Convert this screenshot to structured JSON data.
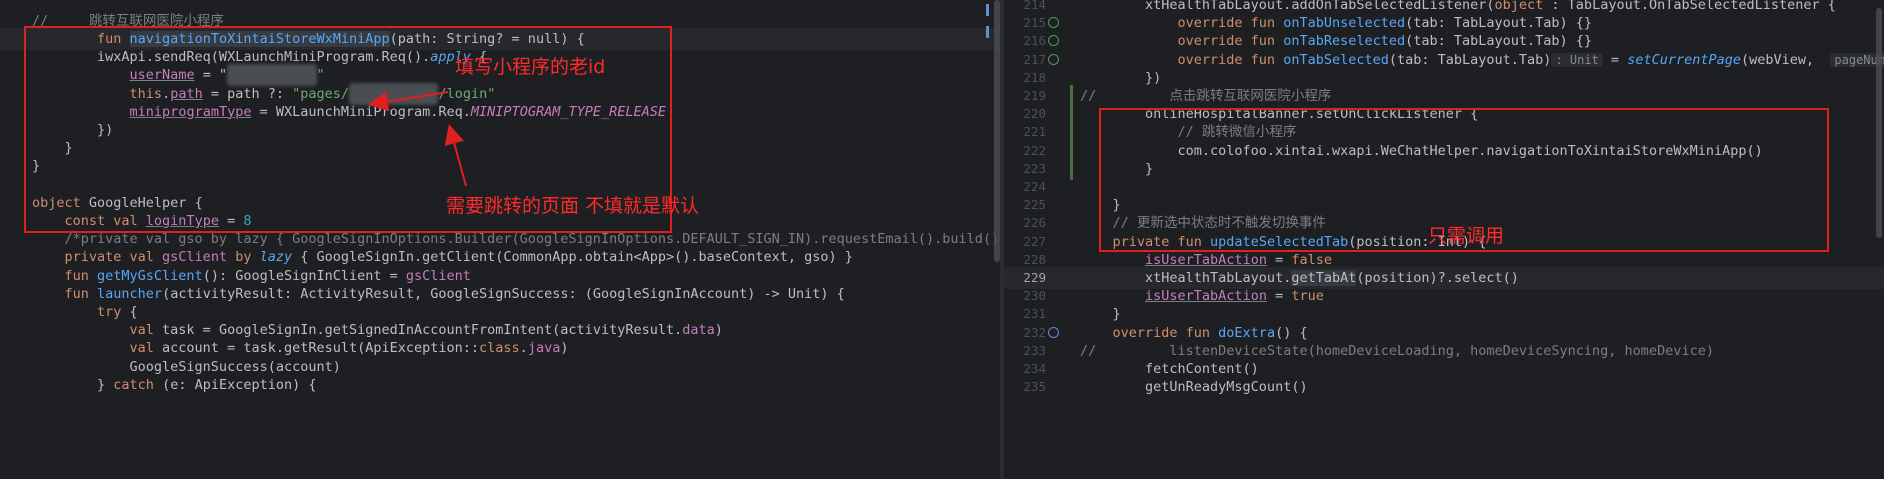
{
  "left_editor": {
    "lines": [
      {
        "tokens": [
          {
            "t": "//     跳转互联网医院小程序",
            "c": "cm"
          }
        ]
      },
      {
        "tokens": [
          {
            "t": "        fun ",
            "c": "kw"
          },
          {
            "t": "navigationToXintaiStoreWxMiniApp",
            "c": "fn hl"
          },
          {
            "t": "(path: String? = null) {",
            "c": ""
          }
        ]
      },
      {
        "tokens": [
          {
            "t": "        iwxApi.sendReq(WXLaunchMiniProgram.Req().",
            "c": ""
          },
          {
            "t": "apply",
            "c": "fn it"
          },
          {
            "t": " {",
            "c": ""
          }
        ]
      },
      {
        "tokens": [
          {
            "t": "            ",
            "c": ""
          },
          {
            "t": "userName",
            "c": "prop und"
          },
          {
            "t": " = \"",
            "c": ""
          },
          {
            "t": "gh_xxxxxxxx",
            "c": "blur"
          },
          {
            "t": "\"",
            "c": "str"
          }
        ]
      },
      {
        "tokens": [
          {
            "t": "            ",
            "c": ""
          },
          {
            "t": "this",
            "c": "kw"
          },
          {
            "t": ".",
            "c": ""
          },
          {
            "t": "path",
            "c": "prop und"
          },
          {
            "t": " = path ?: ",
            "c": ""
          },
          {
            "t": "\"pages/",
            "c": "str"
          },
          {
            "t": "xxxxxxxxxxx",
            "c": "blur"
          },
          {
            "t": "/login\"",
            "c": "str"
          }
        ]
      },
      {
        "tokens": [
          {
            "t": "            ",
            "c": ""
          },
          {
            "t": "miniprogramType",
            "c": "prop und"
          },
          {
            "t": " = WXLaunchMiniProgram.Req.",
            "c": ""
          },
          {
            "t": "MINIPTOGRAM_TYPE_RELEASE",
            "c": "prop it"
          }
        ]
      },
      {
        "tokens": [
          {
            "t": "        })",
            "c": ""
          }
        ]
      },
      {
        "tokens": [
          {
            "t": "    }",
            "c": ""
          }
        ]
      },
      {
        "tokens": [
          {
            "t": "}",
            "c": ""
          }
        ]
      },
      {
        "tokens": [
          {
            "t": "",
            "c": ""
          }
        ]
      },
      {
        "tokens": [
          {
            "t": "object ",
            "c": "kw"
          },
          {
            "t": "GoogleHelper {",
            "c": ""
          }
        ]
      },
      {
        "tokens": [
          {
            "t": "    const val ",
            "c": "kw"
          },
          {
            "t": "loginType",
            "c": "prop und"
          },
          {
            "t": " = ",
            "c": ""
          },
          {
            "t": "8",
            "c": "num"
          }
        ]
      },
      {
        "tokens": [
          {
            "t": "    /*private val gso by lazy { GoogleSignInOptions.Builder(GoogleSignInOptions.DEFAULT_SIGN_IN).requestEmail().build() }*/",
            "c": "cm"
          }
        ]
      },
      {
        "tokens": [
          {
            "t": "    private val ",
            "c": "kw"
          },
          {
            "t": "gsClient",
            "c": "prop"
          },
          {
            "t": " by ",
            "c": "kw"
          },
          {
            "t": "lazy",
            "c": "fn it"
          },
          {
            "t": " { GoogleSignIn.getClient(CommonApp.obtain<App>().baseContext, gso) }",
            "c": ""
          }
        ]
      },
      {
        "tokens": [
          {
            "t": "    fun ",
            "c": "kw"
          },
          {
            "t": "getMyGsClient",
            "c": "fn"
          },
          {
            "t": "(): GoogleSignInClient = ",
            "c": ""
          },
          {
            "t": "gsClient",
            "c": "prop"
          }
        ]
      },
      {
        "tokens": [
          {
            "t": "    fun ",
            "c": "kw"
          },
          {
            "t": "launcher",
            "c": "fn"
          },
          {
            "t": "(activityResult: ActivityResult, GoogleSignSuccess: (GoogleSignInAccount) -> Unit) {",
            "c": ""
          }
        ]
      },
      {
        "tokens": [
          {
            "t": "        try ",
            "c": "kw"
          },
          {
            "t": "{",
            "c": ""
          }
        ]
      },
      {
        "tokens": [
          {
            "t": "            val ",
            "c": "kw"
          },
          {
            "t": "task = GoogleSignIn.getSignedInAccountFromIntent(activityResult.",
            "c": ""
          },
          {
            "t": "data",
            "c": "prop"
          },
          {
            "t": ")",
            "c": ""
          }
        ]
      },
      {
        "tokens": [
          {
            "t": "            val ",
            "c": "kw"
          },
          {
            "t": "account = task.getResult(ApiException::",
            "c": ""
          },
          {
            "t": "class",
            "c": "kw"
          },
          {
            "t": ".",
            "c": ""
          },
          {
            "t": "java",
            "c": "prop"
          },
          {
            "t": ")",
            "c": ""
          }
        ]
      },
      {
        "tokens": [
          {
            "t": "            GoogleSignSuccess(account)",
            "c": ""
          }
        ]
      },
      {
        "tokens": [
          {
            "t": "        } ",
            "c": ""
          },
          {
            "t": "catch ",
            "c": "kw"
          },
          {
            "t": "(e: ApiException) {",
            "c": ""
          }
        ]
      }
    ]
  },
  "right_editor": {
    "lines": [
      {
        "n": "214",
        "tokens": [
          {
            "t": "        xtHealthTabLayout.addOnTabSelectedListener(",
            "c": ""
          },
          {
            "t": "object",
            "c": "kw"
          },
          {
            "t": " : TabLayout.OnTabSelectedListener {",
            "c": ""
          }
        ]
      },
      {
        "n": "215",
        "icon": "green",
        "tokens": [
          {
            "t": "            override fun ",
            "c": "kw"
          },
          {
            "t": "onTabUnselected",
            "c": "fn"
          },
          {
            "t": "(tab: TabLayout.Tab) {}",
            "c": ""
          }
        ]
      },
      {
        "n": "216",
        "icon": "green",
        "tokens": [
          {
            "t": "            override fun ",
            "c": "kw"
          },
          {
            "t": "onTabReselected",
            "c": "fn"
          },
          {
            "t": "(tab: TabLayout.Tab) {}",
            "c": ""
          }
        ]
      },
      {
        "n": "217",
        "icon": "green",
        "tokens": [
          {
            "t": "            override fun ",
            "c": "kw"
          },
          {
            "t": "onTabSelected",
            "c": "fn"
          },
          {
            "t": "(tab: TabLayout.Tab)",
            "c": ""
          },
          {
            "t": ": Unit",
            "c": "hint"
          },
          {
            "t": " = ",
            "c": ""
          },
          {
            "t": "setCurrentPage",
            "c": "fn it"
          },
          {
            "t": "(webView,  ",
            "c": ""
          },
          {
            "t": "pageNumber:",
            "c": "hint"
          }
        ]
      },
      {
        "n": "218",
        "tokens": [
          {
            "t": "        })",
            "c": ""
          }
        ]
      },
      {
        "n": "219",
        "vcs": true,
        "tokens": [
          {
            "t": "//         点击跳转互联网医院小程序",
            "c": "cm"
          }
        ]
      },
      {
        "n": "220",
        "vcs": true,
        "tokens": [
          {
            "t": "        onlineHospitalBanner.setOnClickListener {",
            "c": ""
          }
        ]
      },
      {
        "n": "221",
        "vcs": true,
        "tokens": [
          {
            "t": "            // 跳转微信小程序",
            "c": "cm"
          }
        ]
      },
      {
        "n": "222",
        "vcs": true,
        "tokens": [
          {
            "t": "            com.colofoo.xintai.wxapi.WeChatHelper.navigationToXintaiStoreWxMiniApp()",
            "c": ""
          }
        ]
      },
      {
        "n": "223",
        "vcs": true,
        "tokens": [
          {
            "t": "        }",
            "c": ""
          }
        ]
      },
      {
        "n": "224",
        "tokens": [
          {
            "t": "",
            "c": ""
          }
        ]
      },
      {
        "n": "225",
        "tokens": [
          {
            "t": "    }",
            "c": ""
          }
        ]
      },
      {
        "n": "226",
        "tokens": [
          {
            "t": "    // 更新选中状态时不触发切换事件",
            "c": "cm"
          }
        ]
      },
      {
        "n": "227",
        "tokens": [
          {
            "t": "    private fun ",
            "c": "kw"
          },
          {
            "t": "updateSelectedTab",
            "c": "fn"
          },
          {
            "t": "(position: Int) {",
            "c": ""
          }
        ]
      },
      {
        "n": "228",
        "tokens": [
          {
            "t": "        ",
            "c": ""
          },
          {
            "t": "isUserTabAction",
            "c": "prop und"
          },
          {
            "t": " = ",
            "c": ""
          },
          {
            "t": "false",
            "c": "kw"
          }
        ]
      },
      {
        "n": "229",
        "current": true,
        "tokens": [
          {
            "t": "        xtHealthTabLayout.",
            "c": ""
          },
          {
            "t": "getTabAt",
            "c": "hl"
          },
          {
            "t": "(position)?.select()",
            "c": ""
          }
        ]
      },
      {
        "n": "230",
        "tokens": [
          {
            "t": "        ",
            "c": ""
          },
          {
            "t": "isUserTabAction",
            "c": "prop und"
          },
          {
            "t": " = ",
            "c": ""
          },
          {
            "t": "true",
            "c": "kw"
          }
        ]
      },
      {
        "n": "231",
        "tokens": [
          {
            "t": "    }",
            "c": ""
          }
        ]
      },
      {
        "n": "232",
        "icon": "blue",
        "tokens": [
          {
            "t": "    override fun ",
            "c": "kw"
          },
          {
            "t": "doExtra",
            "c": "fn"
          },
          {
            "t": "() {",
            "c": ""
          }
        ]
      },
      {
        "n": "233",
        "tokens": [
          {
            "t": "//         listenDeviceState(homeDeviceLoading, homeDeviceSyncing, homeDevice)",
            "c": "cm"
          }
        ]
      },
      {
        "n": "234",
        "tokens": [
          {
            "t": "        fetchContent()",
            "c": ""
          }
        ]
      },
      {
        "n": "235",
        "tokens": [
          {
            "t": "        getUnReadyMsgCount()",
            "c": ""
          }
        ]
      }
    ]
  },
  "annotations": {
    "fill_id_note": "填写小程序的老id",
    "page_note": "需要跳转的页面 不填就是默认",
    "only_call_note": "只需调用"
  },
  "colors": {
    "annotation": "#e02020",
    "background": "#1e1f22"
  }
}
